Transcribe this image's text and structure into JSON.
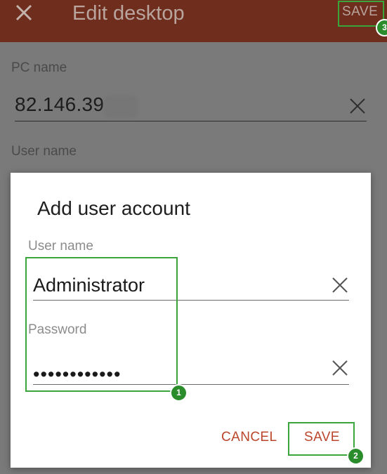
{
  "appbar": {
    "title": "Edit desktop",
    "save_label": "SAVE",
    "close_icon": "close-icon"
  },
  "form": {
    "pc_name_label": "PC name",
    "pc_name_value": "82.146.39",
    "user_name_label": "User name"
  },
  "dialog": {
    "title": "Add user account",
    "user_name_label": "User name",
    "user_name_value": "Administrator",
    "password_label": "Password",
    "password_value": "••••••••••••",
    "cancel_label": "CANCEL",
    "save_label": "SAVE"
  },
  "annotations": {
    "badge_1": "1",
    "badge_2": "2",
    "badge_3": "3",
    "highlight_color": "#3aa53a"
  },
  "colors": {
    "appbar": "#6e2d1d",
    "accent": "#b9462a"
  }
}
